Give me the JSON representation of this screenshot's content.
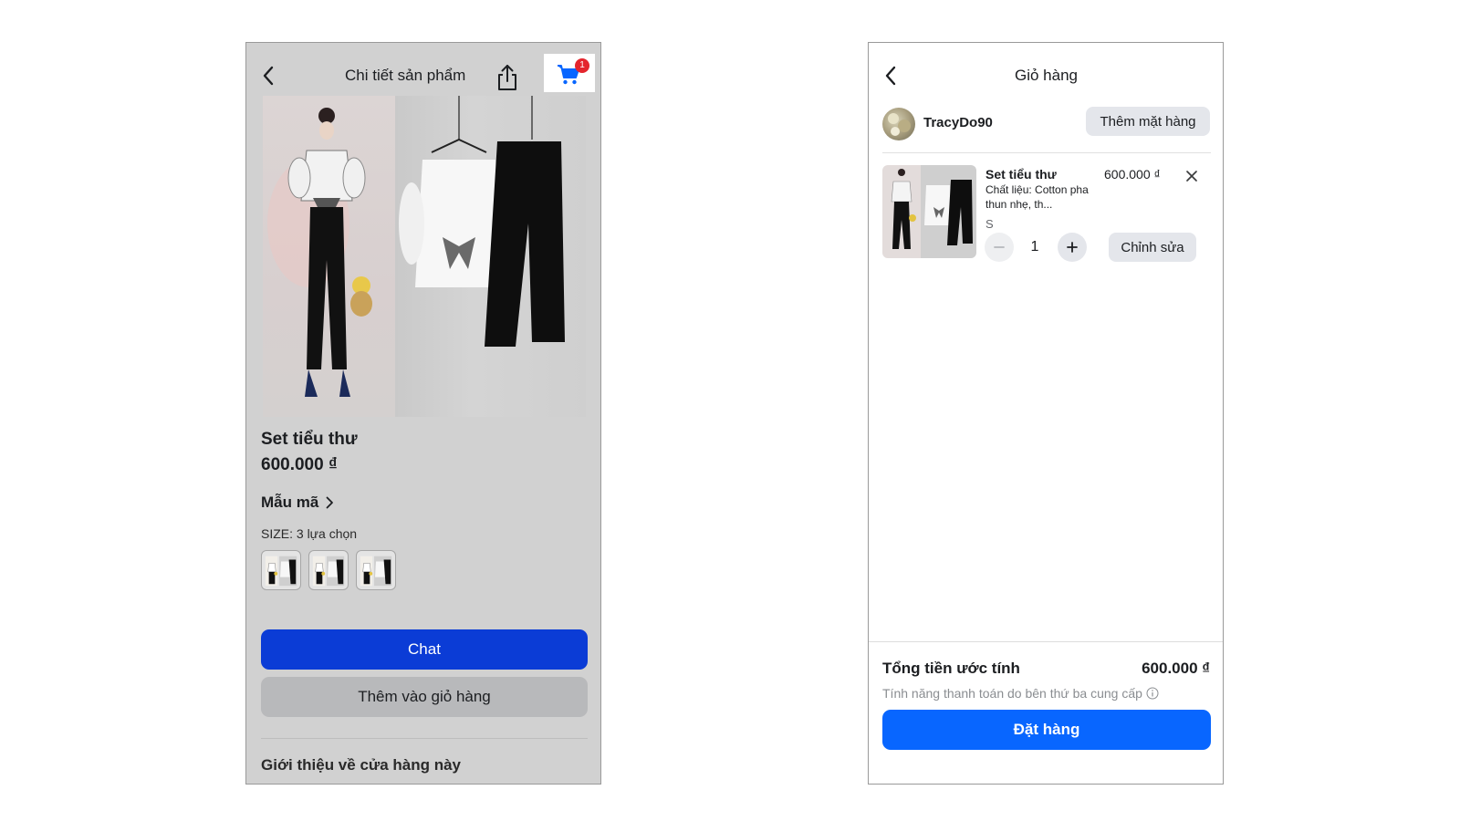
{
  "product_screen": {
    "header": {
      "title": "Chi tiết sản phẩm",
      "cart_badge": "1"
    },
    "product": {
      "name": "Set tiểu thư",
      "price": "600.000 ₫"
    },
    "variants_label": "Mẫu mã",
    "size_label": "SIZE: 3 lựa chọn",
    "size_option_count": 3,
    "chat_label": "Chat",
    "add_to_cart_label": "Thêm vào giỏ hàng",
    "shop_intro": "Giới thiệu về cửa hàng này"
  },
  "cart_screen": {
    "header": {
      "title": "Giỏ hàng"
    },
    "seller": {
      "name": "TracyDo90",
      "add_item_label": "Thêm mặt hàng"
    },
    "item": {
      "name": "Set tiểu thư",
      "description": "Chất liệu: Cotton pha thun nhẹ, th...",
      "size": "S",
      "price": "600.000 ₫",
      "quantity": "1",
      "edit_label": "Chỉnh sửa"
    },
    "summary": {
      "total_label": "Tổng tiền ước tính",
      "total_value": "600.000 ₫",
      "payment_note": "Tính năng thanh toán do bên thứ ba cung cấp",
      "order_label": "Đặt hàng"
    }
  },
  "colors": {
    "chat_button": "#0b3cd6",
    "order_button": "#0866ff",
    "cart_icon": "#0866ff",
    "badge": "#e4252d",
    "left_overlay": "#d1d1d1"
  },
  "icons": [
    "back-icon",
    "share-icon",
    "cart-icon",
    "chevron-right-icon",
    "close-icon",
    "minus-icon",
    "plus-icon",
    "info-icon"
  ]
}
